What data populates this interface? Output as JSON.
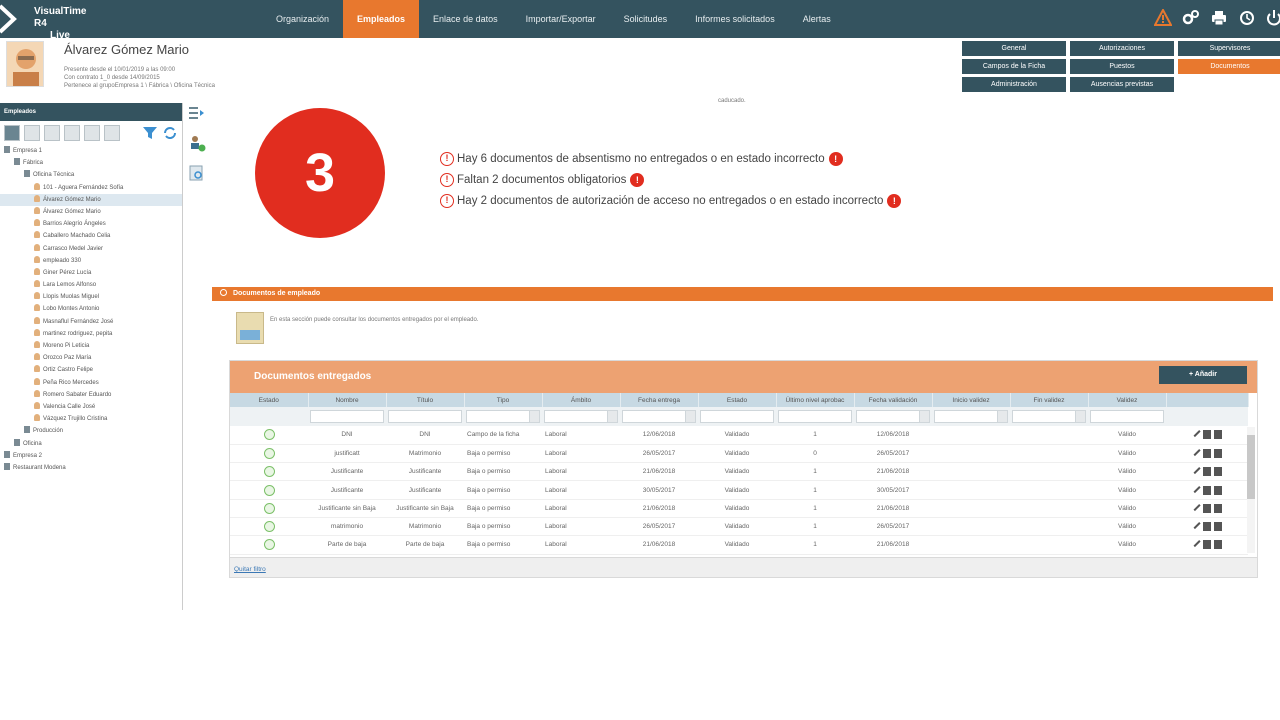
{
  "app": {
    "name_line1": "VisualTime R4",
    "name_line2": "Live"
  },
  "nav": {
    "items": [
      "Organización",
      "Empleados",
      "Enlace de datos",
      "Importar/Exportar",
      "Solicitudes",
      "Informes solicitados",
      "Alertas"
    ],
    "active": "Empleados"
  },
  "top_icons": [
    "warning-icon",
    "gears-icon",
    "print-icon",
    "history-icon",
    "power-icon"
  ],
  "employee": {
    "name": "Álvarez Gómez Mario",
    "meta_line1": "Presente desde el 10/01/2019 a las 09:00",
    "meta_line2": "Con contrato 1_0 desde 14/09/2015",
    "meta_line3": "Pertenece al grupoEmpresa 1 \\ Fábrica \\ Oficina Técnica"
  },
  "tabs": [
    "General",
    "Autorizaciones",
    "Supervisores",
    "Campos de la Ficha",
    "Puestos",
    "Documentos",
    "Administración",
    "Ausencias previstas"
  ],
  "active_tab": "Documentos",
  "sidebar": {
    "title": "Empleados",
    "tree": [
      {
        "label": "Empresa 1",
        "level": 0,
        "type": "building"
      },
      {
        "label": "Fábrica",
        "level": 1,
        "type": "building"
      },
      {
        "label": "Oficina Técnica",
        "level": 2,
        "type": "building"
      },
      {
        "label": "101 - Aguera Fernández Sofía",
        "level": 3,
        "type": "person"
      },
      {
        "label": "Álvarez Gómez Mario",
        "level": 3,
        "type": "person",
        "selected": true
      },
      {
        "label": "Álvarez Gómez Mario",
        "level": 3,
        "type": "person"
      },
      {
        "label": "Barrios Alegrío Ángeles",
        "level": 3,
        "type": "person"
      },
      {
        "label": "Caballero Machado Celia",
        "level": 3,
        "type": "person"
      },
      {
        "label": "Carrasco Medel Javier",
        "level": 3,
        "type": "person"
      },
      {
        "label": "empleado 330",
        "level": 3,
        "type": "person"
      },
      {
        "label": "Giner Pérez Lucía",
        "level": 3,
        "type": "person"
      },
      {
        "label": "Lara Lemos Alfonso",
        "level": 3,
        "type": "person"
      },
      {
        "label": "Llopis Muolas Miguel",
        "level": 3,
        "type": "person"
      },
      {
        "label": "Lobo Montes Antonio",
        "level": 3,
        "type": "person"
      },
      {
        "label": "Masnaflul Fernández José",
        "level": 3,
        "type": "person"
      },
      {
        "label": "martinez rodriguez, pepita",
        "level": 3,
        "type": "person"
      },
      {
        "label": "Moreno Pi Leticia",
        "level": 3,
        "type": "person"
      },
      {
        "label": "Orozco Paz María",
        "level": 3,
        "type": "person"
      },
      {
        "label": "Ortiz Castro Felipe",
        "level": 3,
        "type": "person"
      },
      {
        "label": "Peña Rico Mercedes",
        "level": 3,
        "type": "person"
      },
      {
        "label": "Romero Sabater Eduardo",
        "level": 3,
        "type": "person"
      },
      {
        "label": "Valencia Calle José",
        "level": 3,
        "type": "person"
      },
      {
        "label": "Vázquez Trujillo Cristina",
        "level": 3,
        "type": "person"
      },
      {
        "label": "Producción",
        "level": 2,
        "type": "building"
      },
      {
        "label": "Oficina",
        "level": 1,
        "type": "building"
      },
      {
        "label": "Empresa 2",
        "level": 0,
        "type": "building"
      },
      {
        "label": "Restaurant Modena",
        "level": 0,
        "type": "building"
      }
    ]
  },
  "summary": {
    "truncated_text": "caducado.",
    "count": "3",
    "alerts": [
      "Hay 6 documentos de absentismo no entregados o en estado incorrecto",
      "Faltan 2 documentos obligatorios",
      "Hay 2 documentos de autorización de acceso no entregados o en estado incorrecto"
    ]
  },
  "section": {
    "title": "Documentos de empleado",
    "description": "En esta sección puede consultar los documentos entregados por el empleado."
  },
  "grid": {
    "title": "Documentos entregados",
    "add_label": "+ Añadir",
    "columns": [
      "Estado",
      "Nombre",
      "Título",
      "Tipo",
      "Ámbito",
      "Fecha entrega",
      "Estado",
      "Último nivel aprobac",
      "Fecha validación",
      "Inicio validez",
      "Fin validez",
      "Validez"
    ],
    "rows": [
      [
        "DNI",
        "DNI",
        "Campo de la ficha",
        "Laboral",
        "12/06/2018",
        "Validado",
        "1",
        "12/06/2018",
        "",
        "",
        "Válido"
      ],
      [
        "justificatt",
        "Matrimonio",
        "Baja o permiso",
        "Laboral",
        "26/05/2017",
        "Validado",
        "0",
        "26/05/2017",
        "",
        "",
        "Válido"
      ],
      [
        "Justificante",
        "Justificante",
        "Baja o permiso",
        "Laboral",
        "21/06/2018",
        "Validado",
        "1",
        "21/06/2018",
        "",
        "",
        "Válido"
      ],
      [
        "Justificante",
        "Justificante",
        "Baja o permiso",
        "Laboral",
        "30/05/2017",
        "Validado",
        "1",
        "30/05/2017",
        "",
        "",
        "Válido"
      ],
      [
        "Justificante sin Baja",
        "Justificante sin Baja",
        "Baja o permiso",
        "Laboral",
        "21/06/2018",
        "Validado",
        "1",
        "21/06/2018",
        "",
        "",
        "Válido"
      ],
      [
        "matrimonio",
        "Matrimonio",
        "Baja o permiso",
        "Laboral",
        "26/05/2017",
        "Validado",
        "1",
        "26/05/2017",
        "",
        "",
        "Válido"
      ],
      [
        "Parte de baja",
        "Parte de baja",
        "Baja o permiso",
        "Laboral",
        "21/06/2018",
        "Validado",
        "1",
        "21/06/2018",
        "",
        "",
        "Válido"
      ]
    ],
    "clear_filter": "Quitar filtro"
  }
}
